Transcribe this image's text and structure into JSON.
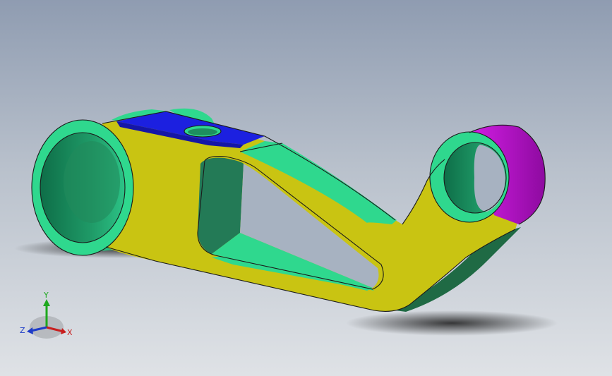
{
  "viewport": {
    "background_top": "#8f9cb1",
    "background_bottom": "#dfe2e6"
  },
  "part": {
    "face_colors": {
      "side_face": "#c9c412",
      "cylinder_face": "#2fd88e",
      "cylinder_inner": "#1e8f5f",
      "top_flat_face": "#1c20e0",
      "highlight_boss": "#b814c8",
      "underside": "#1f6a44"
    }
  },
  "triad": {
    "x_label": "X",
    "y_label": "Y",
    "z_label": "Z",
    "x_color": "#c81e1e",
    "y_color": "#1ea81e",
    "z_color": "#1e3cc8"
  }
}
